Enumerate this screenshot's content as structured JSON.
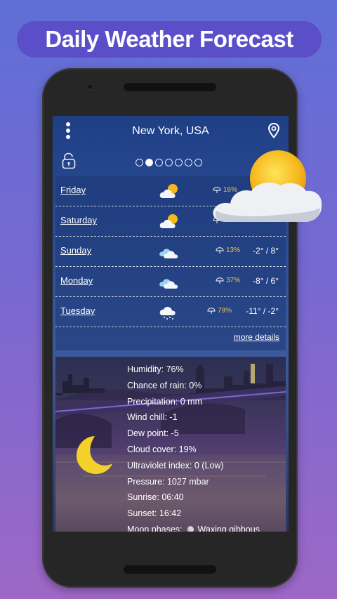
{
  "banner": {
    "title": "Daily Weather Forecast"
  },
  "header": {
    "city": "New York, USA",
    "page_dots": 7,
    "active_dot": 1
  },
  "forecast": [
    {
      "day": "Friday",
      "icon": "partly-cloudy-icon",
      "rain": "16%",
      "temps": ""
    },
    {
      "day": "Saturday",
      "icon": "partly-cloudy-icon",
      "rain": "1",
      "temps": ""
    },
    {
      "day": "Sunday",
      "icon": "cloudy-icon",
      "rain": "13%",
      "temps": "-2° / 8°"
    },
    {
      "day": "Monday",
      "icon": "cloudy-icon",
      "rain": "37%",
      "temps": "-8° / 6°"
    },
    {
      "day": "Tuesday",
      "icon": "snow-cloud-icon",
      "rain": "79%",
      "temps": "-11° / -2°"
    }
  ],
  "more_details": "more details",
  "details": {
    "humidity": "Humidity: 76%",
    "chance_of_rain": "Chance of rain: 0%",
    "precipitation": "Precipitation: 0 mm",
    "wind_chill": "Wind chill: -1",
    "dew_point": "Dew point: -5",
    "cloud_cover": "Cloud cover: 19%",
    "uv_index": "Ultraviolet index: 0 (Low)",
    "pressure": "Pressure: 1027 mbar",
    "sunrise": "Sunrise: 06:40",
    "sunset": "Sunset: 16:42",
    "moon_label": "Moon phases:",
    "moon_value": "Waxing gibbous"
  },
  "colors": {
    "banner": "#5b4fc9",
    "rain_text": "#f3c24a",
    "sun": "#f6b81c",
    "moon": "#f3d12a"
  }
}
